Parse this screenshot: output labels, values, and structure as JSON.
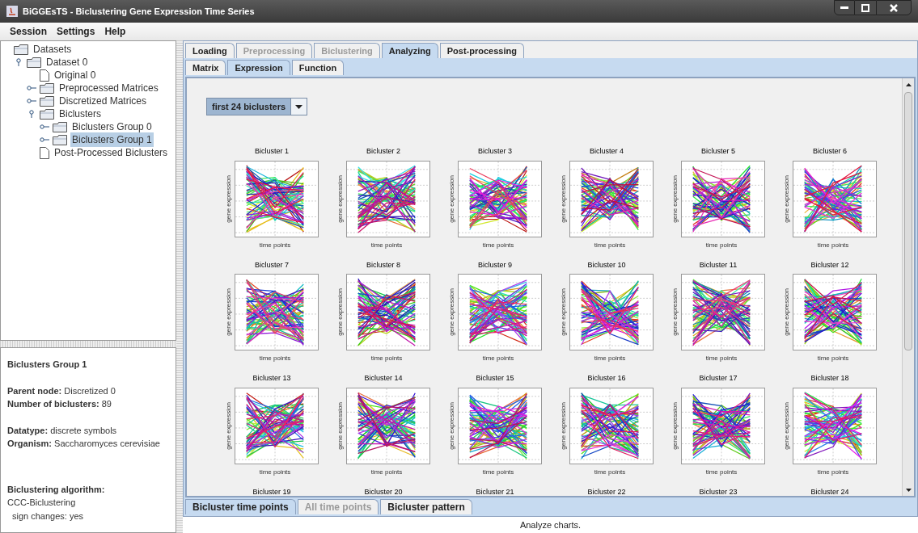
{
  "window": {
    "title": "BiGGEsTS - Biclustering Gene Expression Time Series"
  },
  "menu": [
    "Session",
    "Settings",
    "Help"
  ],
  "tree": {
    "label": "Datasets",
    "kind": "folder",
    "children": [
      {
        "label": "Dataset 0",
        "kind": "folder",
        "expanded": true,
        "selected": false,
        "children": [
          {
            "label": "Original 0",
            "kind": "file",
            "selected": false
          },
          {
            "label": "Preprocessed Matrices",
            "kind": "folder",
            "expanded": false,
            "selected": false
          },
          {
            "label": "Discretized Matrices",
            "kind": "folder",
            "expanded": false,
            "selected": false
          },
          {
            "label": "Biclusters",
            "kind": "folder",
            "expanded": true,
            "selected": false,
            "children": [
              {
                "label": "Biclusters Group 0",
                "kind": "folder",
                "expanded": false,
                "selected": false
              },
              {
                "label": "Biclusters Group 1",
                "kind": "folder",
                "expanded": false,
                "selected": true
              }
            ]
          },
          {
            "label": "Post-Processed Biclusters",
            "kind": "file",
            "selected": false
          }
        ]
      }
    ]
  },
  "details": {
    "title": "Biclusters Group 1",
    "groups": [
      [
        "**Parent node:** Discretized 0",
        "**Number of biclusters:** 89"
      ],
      [
        "**Datatype:** discrete symbols",
        "**Organism:** Saccharomyces cerevisiae"
      ]
    ],
    "algorithm_label": "Biclustering algorithm:",
    "algorithm": "CCC-Biclustering",
    "algorithm_option": "sign changes: yes"
  },
  "tabs": [
    {
      "label": "Loading",
      "selected": false,
      "disabled": false
    },
    {
      "label": "Preprocessing",
      "selected": false,
      "disabled": true
    },
    {
      "label": "Biclustering",
      "selected": false,
      "disabled": true
    },
    {
      "label": "Analyzing",
      "selected": true,
      "disabled": false
    },
    {
      "label": "Post-processing",
      "selected": false,
      "disabled": false
    }
  ],
  "subtabs": [
    {
      "label": "Matrix",
      "selected": false
    },
    {
      "label": "Expression",
      "selected": true
    },
    {
      "label": "Function",
      "selected": false
    }
  ],
  "selector": {
    "value": "first 24 biclusters"
  },
  "biclusters": [
    {
      "title": "Bicluster 1",
      "kind": "full",
      "ylabel": "gene expression",
      "xlabel": "time points"
    },
    {
      "title": "Bicluster 2",
      "kind": "full",
      "ylabel": "gene expression",
      "xlabel": "time points"
    },
    {
      "title": "Bicluster 3",
      "kind": "full",
      "ylabel": "gene expression",
      "xlabel": "time points"
    },
    {
      "title": "Bicluster 4",
      "kind": "full",
      "ylabel": "gene expression",
      "xlabel": "time points"
    },
    {
      "title": "Bicluster 5",
      "kind": "full",
      "ylabel": "gene expression",
      "xlabel": "time points"
    },
    {
      "title": "Bicluster 6",
      "kind": "full",
      "ylabel": "gene expression",
      "xlabel": "time points"
    },
    {
      "title": "Bicluster 7",
      "kind": "full",
      "ylabel": "gene expression",
      "xlabel": "time points"
    },
    {
      "title": "Bicluster 8",
      "kind": "full",
      "ylabel": "gene expression",
      "xlabel": "time points"
    },
    {
      "title": "Bicluster 9",
      "kind": "full",
      "ylabel": "gene expression",
      "xlabel": "time points"
    },
    {
      "title": "Bicluster 10",
      "kind": "full",
      "ylabel": "gene expression",
      "xlabel": "time points"
    },
    {
      "title": "Bicluster 11",
      "kind": "full",
      "ylabel": "gene expression",
      "xlabel": "time points"
    },
    {
      "title": "Bicluster 12",
      "kind": "full",
      "ylabel": "gene expression",
      "xlabel": "time points"
    },
    {
      "title": "Bicluster 13",
      "kind": "full",
      "ylabel": "gene expression",
      "xlabel": "time points"
    },
    {
      "title": "Bicluster 14",
      "kind": "full",
      "ylabel": "gene expression",
      "xlabel": "time points"
    },
    {
      "title": "Bicluster 15",
      "kind": "full",
      "ylabel": "gene expression",
      "xlabel": "time points"
    },
    {
      "title": "Bicluster 16",
      "kind": "full",
      "ylabel": "gene expression",
      "xlabel": "time points"
    },
    {
      "title": "Bicluster 17",
      "kind": "full",
      "ylabel": "gene expression",
      "xlabel": "time points"
    },
    {
      "title": "Bicluster 18",
      "kind": "full",
      "ylabel": "gene expression",
      "xlabel": "time points"
    },
    {
      "title": "Bicluster 19",
      "kind": "cut"
    },
    {
      "title": "Bicluster 20",
      "kind": "cut"
    },
    {
      "title": "Bicluster 21",
      "kind": "cut"
    },
    {
      "title": "Bicluster 22",
      "kind": "cut"
    },
    {
      "title": "Bicluster 23",
      "kind": "cut"
    },
    {
      "title": "Bicluster 24",
      "kind": "cut"
    }
  ],
  "bottom_tabs": [
    {
      "label": "Bicluster time points",
      "selected": true,
      "disabled": false
    },
    {
      "label": "All time points",
      "selected": false,
      "disabled": true
    },
    {
      "label": "Bicluster pattern",
      "selected": false,
      "disabled": false
    }
  ],
  "status_bar": "Analyze charts."
}
